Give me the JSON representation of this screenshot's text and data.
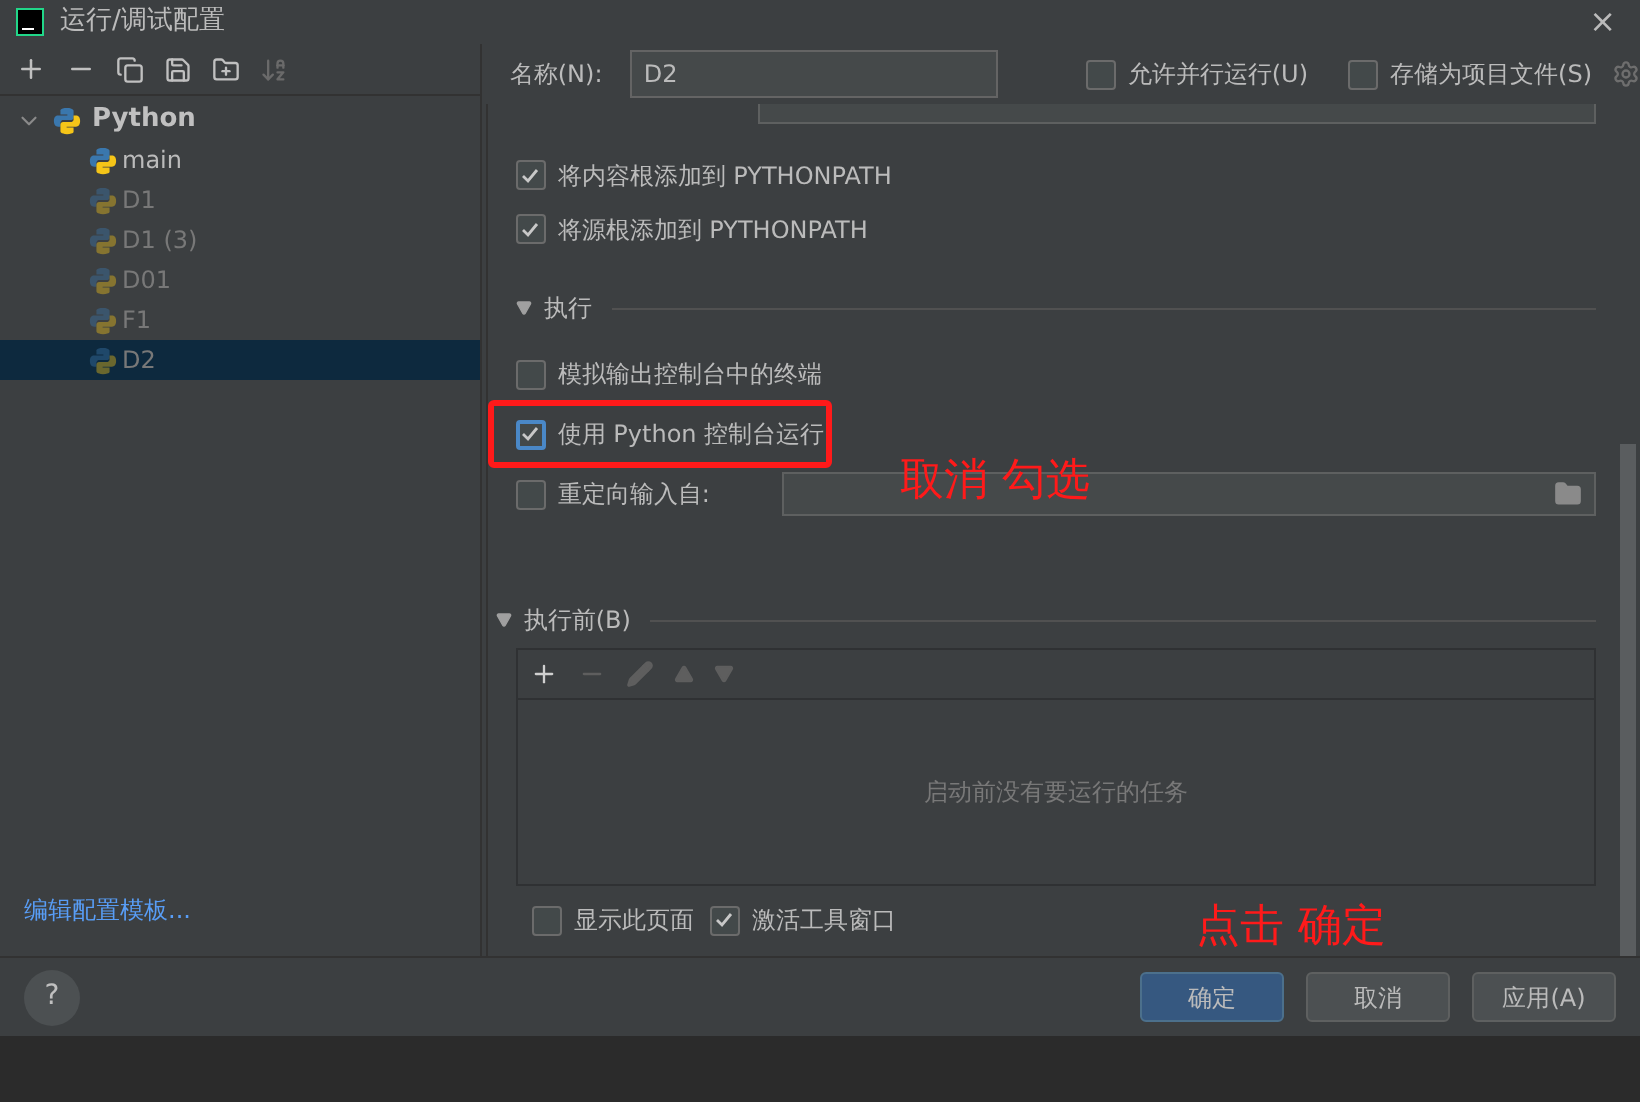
{
  "window": {
    "title": "运行/调试配置",
    "close": "×"
  },
  "sidebar": {
    "tree": [
      {
        "label": "Python",
        "expanded": true,
        "children": [
          {
            "label": "main",
            "dimmed": false,
            "selected": false
          },
          {
            "label": "D1",
            "dimmed": true,
            "selected": false
          },
          {
            "label": "D1 (3)",
            "dimmed": true,
            "selected": false
          },
          {
            "label": "D01",
            "dimmed": true,
            "selected": false
          },
          {
            "label": "F1",
            "dimmed": true,
            "selected": false
          },
          {
            "label": "D2",
            "dimmed": true,
            "selected": true
          }
        ]
      }
    ],
    "link": "编辑配置模板..."
  },
  "name_row": {
    "label": "名称(N):",
    "value": "D2",
    "options": [
      {
        "label": "允许并行运行(U)",
        "checked": false
      },
      {
        "label": "存储为项目文件(S)",
        "checked": false
      }
    ]
  },
  "options_top": [
    {
      "label": "将内容根添加到 PYTHONPATH",
      "checked": true
    },
    {
      "label": "将源根添加到 PYTHONPATH",
      "checked": true
    }
  ],
  "execution": {
    "title": "执行",
    "expanded": true,
    "options": [
      {
        "kind": "checkbox",
        "label": "模拟输出控制台中的终端",
        "checked": false,
        "highlighted": false
      },
      {
        "kind": "checkbox",
        "label": "使用 Python 控制台运行",
        "checked": true,
        "highlighted": true
      },
      {
        "kind": "file",
        "label": "重定向输入自:",
        "checked": false,
        "highlighted": false
      }
    ]
  },
  "before_launch": {
    "title": "执行前(B)",
    "expanded": true,
    "empty_text": "启动前没有要运行的任务"
  },
  "footer_options": [
    {
      "label": "显示此页面",
      "checked": false
    },
    {
      "label": "激活工具窗口",
      "checked": true
    }
  ],
  "buttons": [
    {
      "label": "确定",
      "primary": true
    },
    {
      "label": "取消",
      "primary": false
    },
    {
      "label": "应用(A)",
      "primary": false
    }
  ],
  "help": "?",
  "annotations": [
    "取消 勾选",
    "点击 确定"
  ]
}
